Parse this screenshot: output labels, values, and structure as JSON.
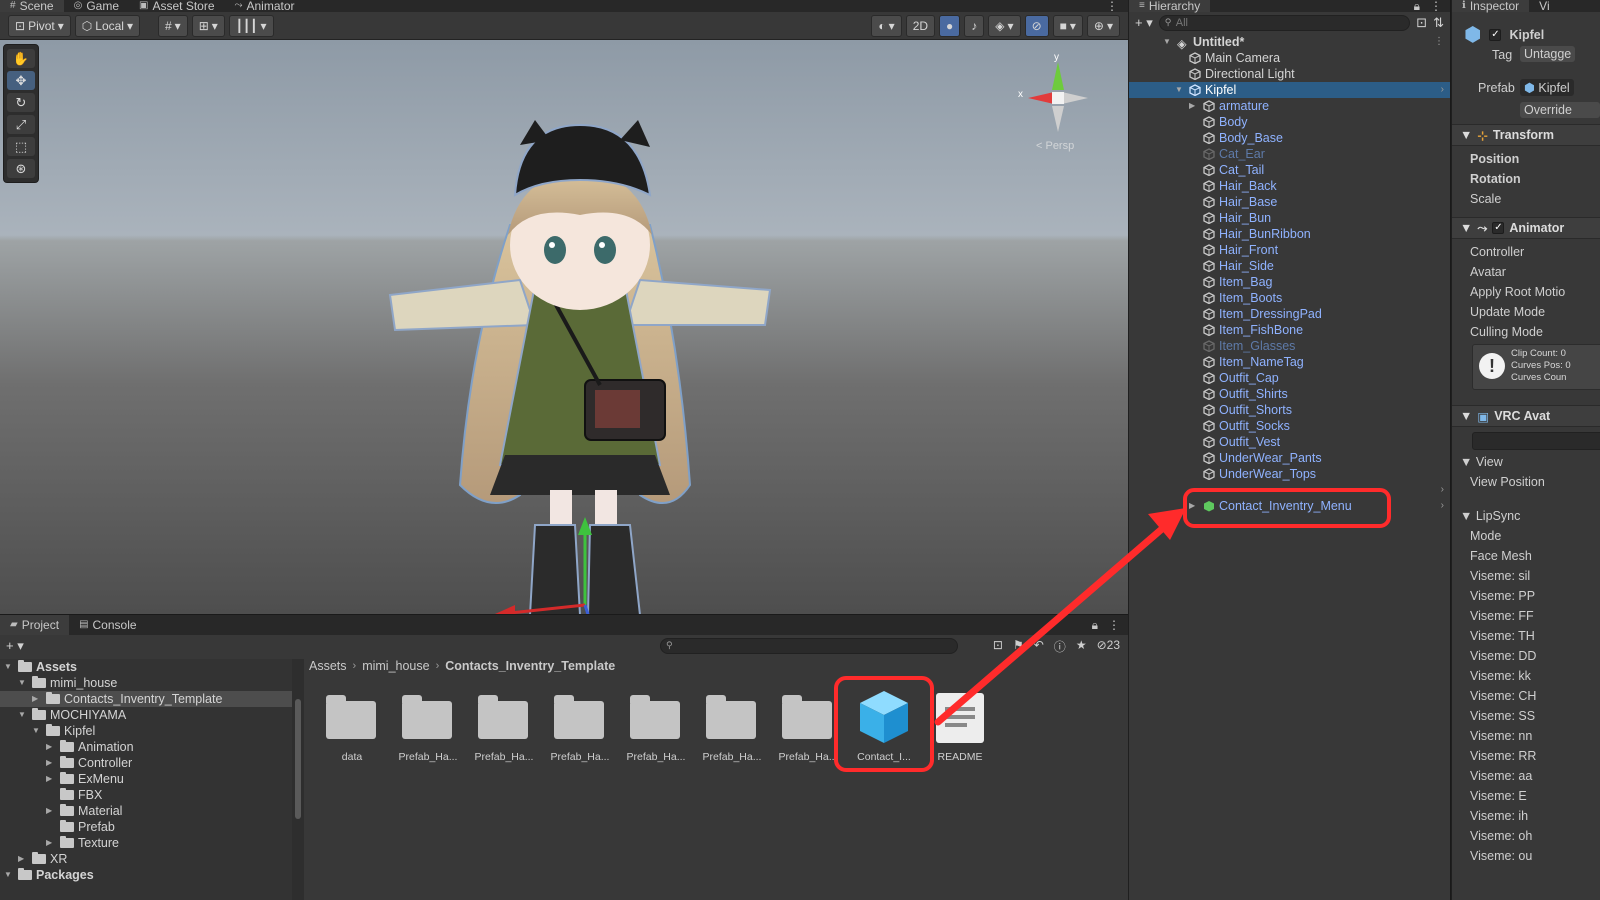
{
  "scene_panel": {
    "tabs": [
      {
        "label": "Scene",
        "icon": "grid-icon"
      },
      {
        "label": "Game",
        "icon": "gamepad-icon"
      },
      {
        "label": "Asset Store",
        "icon": "bag-icon"
      },
      {
        "label": "Animator",
        "icon": "animator-icon"
      }
    ],
    "toolbar": {
      "pivot_label": "Pivot",
      "local_label": "Local",
      "mode_2d_label": "2D"
    },
    "gizmo": {
      "y_label": "y",
      "x_label": "x",
      "persp_label": "< Persp"
    }
  },
  "hierarchy": {
    "tab_label": "Hierarchy",
    "search_placeholder": "All",
    "scene_name": "Untitled*",
    "items": [
      {
        "label": "Main Camera",
        "depth": 1,
        "state": "normal"
      },
      {
        "label": "Directional Light",
        "depth": 1,
        "state": "normal"
      },
      {
        "label": "Kipfel",
        "depth": 1,
        "state": "selected"
      },
      {
        "label": "armature",
        "depth": 2,
        "state": "prefab"
      },
      {
        "label": "Body",
        "depth": 2,
        "state": "prefab"
      },
      {
        "label": "Body_Base",
        "depth": 2,
        "state": "prefab"
      },
      {
        "label": "Cat_Ear",
        "depth": 2,
        "state": "inactive"
      },
      {
        "label": "Cat_Tail",
        "depth": 2,
        "state": "prefab"
      },
      {
        "label": "Hair_Back",
        "depth": 2,
        "state": "prefab"
      },
      {
        "label": "Hair_Base",
        "depth": 2,
        "state": "prefab"
      },
      {
        "label": "Hair_Bun",
        "depth": 2,
        "state": "prefab"
      },
      {
        "label": "Hair_BunRibbon",
        "depth": 2,
        "state": "prefab"
      },
      {
        "label": "Hair_Front",
        "depth": 2,
        "state": "prefab"
      },
      {
        "label": "Hair_Side",
        "depth": 2,
        "state": "prefab"
      },
      {
        "label": "Item_Bag",
        "depth": 2,
        "state": "prefab"
      },
      {
        "label": "Item_Boots",
        "depth": 2,
        "state": "prefab"
      },
      {
        "label": "Item_DressingPad",
        "depth": 2,
        "state": "prefab"
      },
      {
        "label": "Item_FishBone",
        "depth": 2,
        "state": "prefab"
      },
      {
        "label": "Item_Glasses",
        "depth": 2,
        "state": "inactive"
      },
      {
        "label": "Item_NameTag",
        "depth": 2,
        "state": "prefab"
      },
      {
        "label": "Outfit_Cap",
        "depth": 2,
        "state": "prefab"
      },
      {
        "label": "Outfit_Shirts",
        "depth": 2,
        "state": "prefab"
      },
      {
        "label": "Outfit_Shorts",
        "depth": 2,
        "state": "prefab"
      },
      {
        "label": "Outfit_Socks",
        "depth": 2,
        "state": "prefab"
      },
      {
        "label": "Outfit_Vest",
        "depth": 2,
        "state": "prefab"
      },
      {
        "label": "UnderWear_Pants",
        "depth": 2,
        "state": "prefab"
      },
      {
        "label": "UnderWear_Tops",
        "depth": 2,
        "state": "prefab"
      }
    ],
    "new_item_label": "Contact_Inventry_Menu"
  },
  "inspector": {
    "tab_label": "Inspector",
    "tab2_label": "Vi",
    "object_name": "Kipfel",
    "tag_label": "Tag",
    "tag_value": "Untagge",
    "prefab_label": "Prefab",
    "prefab_value": "Kipfel",
    "overrides_label": "Override",
    "transform_header": "Transform",
    "transform_fields": [
      "Position",
      "Rotation",
      "Scale"
    ],
    "animator_header": "Animator",
    "animator_fields": [
      "Controller",
      "Avatar",
      "Apply Root Motio",
      "Update Mode",
      "Culling Mode"
    ],
    "warning_lines": [
      "Clip Count: 0",
      "Curves Pos: 0",
      "Curves Coun"
    ],
    "vrc_header": "VRC Avat",
    "view_section": "View",
    "view_position": "View Position",
    "lipsync_section": "LipSync",
    "lipsync_fields": [
      "Mode",
      "Face Mesh",
      "Viseme: sil",
      "Viseme: PP",
      "Viseme: FF",
      "Viseme: TH",
      "Viseme: DD",
      "Viseme: kk",
      "Viseme: CH",
      "Viseme: SS",
      "Viseme: nn",
      "Viseme: RR",
      "Viseme: aa",
      "Viseme: E",
      "Viseme: ih",
      "Viseme: oh",
      "Viseme: ou"
    ]
  },
  "project": {
    "tabs": [
      {
        "label": "Project",
        "icon": "folder-icon"
      },
      {
        "label": "Console",
        "icon": "console-icon"
      }
    ],
    "hidden_count": "23",
    "tree": [
      {
        "label": "Assets",
        "depth": 0,
        "bold": true
      },
      {
        "label": "mimi_house",
        "depth": 1,
        "bold": false
      },
      {
        "label": "Contacts_Inventry_Template",
        "depth": 2,
        "bold": false
      },
      {
        "label": "MOCHIYAMA",
        "depth": 1,
        "bold": false
      },
      {
        "label": "Kipfel",
        "depth": 2,
        "bold": false
      },
      {
        "label": "Animation",
        "depth": 3,
        "bold": false
      },
      {
        "label": "Controller",
        "depth": 3,
        "bold": false
      },
      {
        "label": "ExMenu",
        "depth": 3,
        "bold": false
      },
      {
        "label": "FBX",
        "depth": 3,
        "bold": false
      },
      {
        "label": "Material",
        "depth": 3,
        "bold": false
      },
      {
        "label": "Prefab",
        "depth": 3,
        "bold": false
      },
      {
        "label": "Texture",
        "depth": 3,
        "bold": false
      },
      {
        "label": "XR",
        "depth": 1,
        "bold": false
      },
      {
        "label": "Packages",
        "depth": 0,
        "bold": true
      }
    ],
    "breadcrumb": [
      "Assets",
      "mimi_house",
      "Contacts_Inventry_Template"
    ],
    "assets": [
      {
        "label": "data",
        "kind": "folder"
      },
      {
        "label": "Prefab_Ha...",
        "kind": "folder"
      },
      {
        "label": "Prefab_Ha...",
        "kind": "folder"
      },
      {
        "label": "Prefab_Ha...",
        "kind": "folder"
      },
      {
        "label": "Prefab_Ha...",
        "kind": "folder"
      },
      {
        "label": "Prefab_Ha...",
        "kind": "folder"
      },
      {
        "label": "Prefab_Ha...",
        "kind": "folder"
      },
      {
        "label": "Contact_I...",
        "kind": "prefab"
      },
      {
        "label": "README",
        "kind": "readme"
      }
    ]
  },
  "colors": {
    "highlight": "#ff2b2b",
    "selection": "#2c5d87",
    "prefab_text": "#8fb2ff"
  }
}
